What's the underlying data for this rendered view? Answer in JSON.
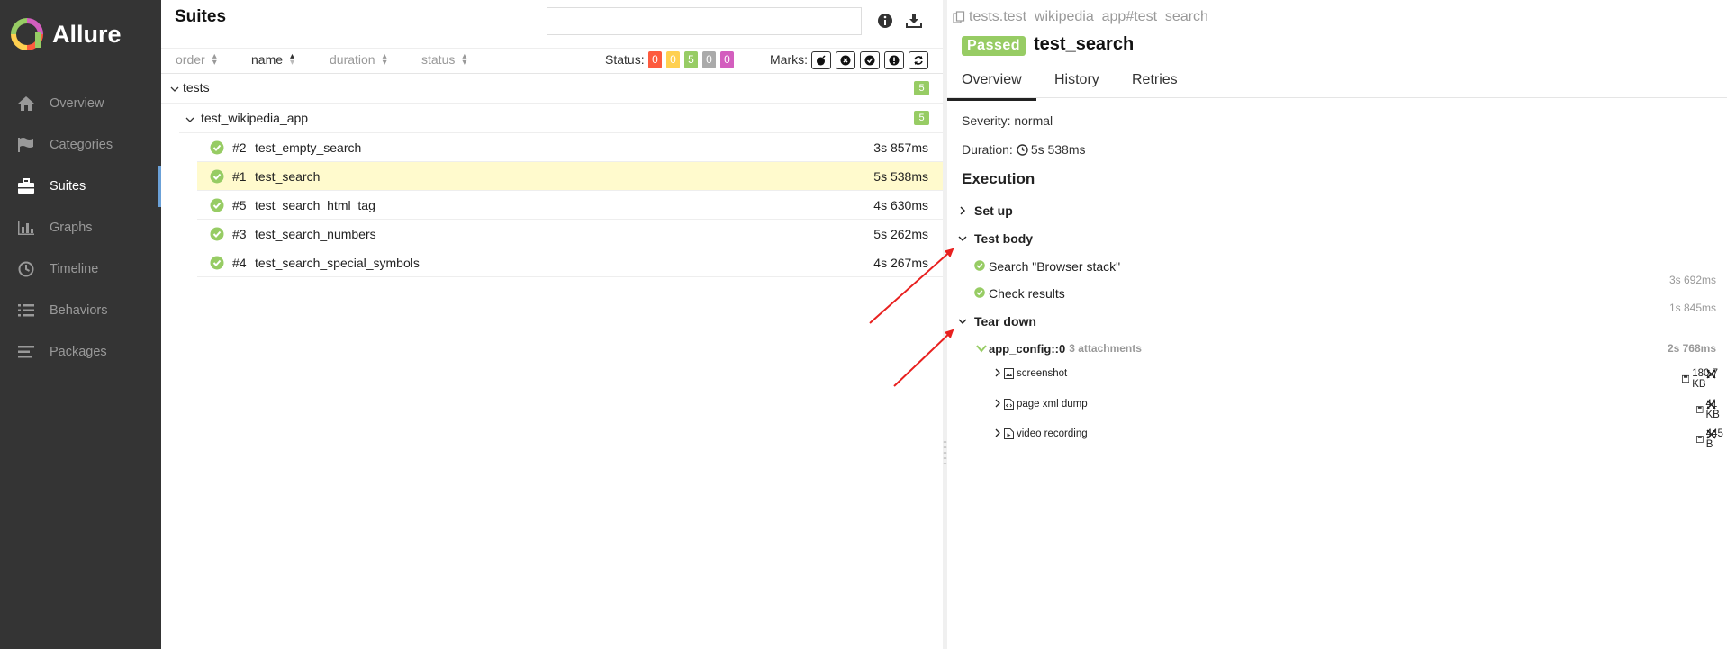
{
  "sidebar": {
    "brand": "Allure",
    "items": [
      {
        "label": "Overview",
        "icon": "home-icon"
      },
      {
        "label": "Categories",
        "icon": "flag-icon"
      },
      {
        "label": "Suites",
        "icon": "briefcase-icon",
        "active": true
      },
      {
        "label": "Graphs",
        "icon": "bar-chart-icon"
      },
      {
        "label": "Timeline",
        "icon": "clock-icon"
      },
      {
        "label": "Behaviors",
        "icon": "list-icon"
      },
      {
        "label": "Packages",
        "icon": "align-left-icon"
      }
    ]
  },
  "suites": {
    "title": "Suites",
    "search_placeholder": "",
    "sorters": {
      "order": "order",
      "name": "name",
      "duration": "duration",
      "status": "status"
    },
    "status_label": "Status:",
    "status_counts": [
      {
        "value": "0",
        "color": "#fd5a3e"
      },
      {
        "value": "0",
        "color": "#ffd050"
      },
      {
        "value": "5",
        "color": "#97cc64"
      },
      {
        "value": "0",
        "color": "#aaaaaa"
      },
      {
        "value": "0",
        "color": "#d35ebe"
      }
    ],
    "marks_label": "Marks:",
    "tree": {
      "root": {
        "label": "tests",
        "count": "5"
      },
      "child": {
        "label": "test_wikipedia_app",
        "count": "5"
      },
      "tests": [
        {
          "num": "#2",
          "name": "test_empty_search",
          "duration": "3s 857ms"
        },
        {
          "num": "#1",
          "name": "test_search",
          "duration": "5s 538ms",
          "selected": true
        },
        {
          "num": "#5",
          "name": "test_search_html_tag",
          "duration": "4s 630ms"
        },
        {
          "num": "#3",
          "name": "test_search_numbers",
          "duration": "5s 262ms"
        },
        {
          "num": "#4",
          "name": "test_search_special_symbols",
          "duration": "4s 267ms"
        }
      ]
    }
  },
  "testcase": {
    "breadcrumb": "tests.test_wikipedia_app#test_search",
    "status": "Passed",
    "title": "test_search",
    "tabs": [
      "Overview",
      "History",
      "Retries"
    ],
    "severity": "Severity: normal",
    "duration_label": "Duration:",
    "duration": "5s 538ms",
    "execution_title": "Execution",
    "setup": "Set up",
    "body": "Test body",
    "steps": [
      {
        "label": "Search \"Browser stack\"",
        "duration": "3s 692ms"
      },
      {
        "label": "Check results",
        "duration": "1s 845ms"
      }
    ],
    "teardown": "Tear down",
    "fixture": {
      "name": "app_config::0",
      "attachments": "3 attachments",
      "duration": "2s 768ms"
    },
    "attachments": [
      {
        "name": "screenshot",
        "size": "180.7 KB"
      },
      {
        "name": "page xml dump",
        "size": "41 KB"
      },
      {
        "name": "video recording",
        "size": "445 B"
      }
    ]
  },
  "colors": {
    "passed": "#97cc64",
    "sidebar": "#343434",
    "selected_row": "#fffacd",
    "annotation_arrow": "#e8201f"
  }
}
